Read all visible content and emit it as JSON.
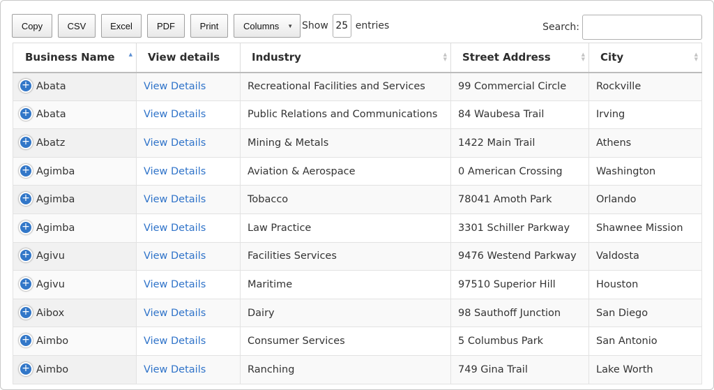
{
  "toolbar": {
    "copy_label": "Copy",
    "csv_label": "CSV",
    "excel_label": "Excel",
    "pdf_label": "PDF",
    "print_label": "Print",
    "columns_label": "Columns"
  },
  "length": {
    "show_label": "Show",
    "value": "25",
    "entries_label": "entries"
  },
  "search": {
    "label": "Search:",
    "value": ""
  },
  "table": {
    "columns": [
      "Business Name",
      "View details",
      "Industry",
      "Street Address",
      "City"
    ],
    "rows": [
      [
        "Abata",
        "View Details",
        "Recreational Facilities and Services",
        "99 Commercial Circle",
        "Rockville"
      ],
      [
        "Abata",
        "View Details",
        "Public Relations and Communications",
        "84 Waubesa Trail",
        "Irving"
      ],
      [
        "Abatz",
        "View Details",
        "Mining & Metals",
        "1422 Main Trail",
        "Athens"
      ],
      [
        "Agimba",
        "View Details",
        "Aviation & Aerospace",
        "0 American Crossing",
        "Washington"
      ],
      [
        "Agimba",
        "View Details",
        "Tobacco",
        "78041 Amoth Park",
        "Orlando"
      ],
      [
        "Agimba",
        "View Details",
        "Law Practice",
        "3301 Schiller Parkway",
        "Shawnee Mission"
      ],
      [
        "Agivu",
        "View Details",
        "Facilities Services",
        "9476 Westend Parkway",
        "Valdosta"
      ],
      [
        "Agivu",
        "View Details",
        "Maritime",
        "97510 Superior Hill",
        "Houston"
      ],
      [
        "Aibox",
        "View Details",
        "Dairy",
        "98 Sauthoff Junction",
        "San Diego"
      ],
      [
        "Aimbo",
        "View Details",
        "Consumer Services",
        "5 Columbus Park",
        "San Antonio"
      ],
      [
        "Aimbo",
        "View Details",
        "Ranching",
        "749 Gina Trail",
        "Lake Worth"
      ]
    ]
  }
}
